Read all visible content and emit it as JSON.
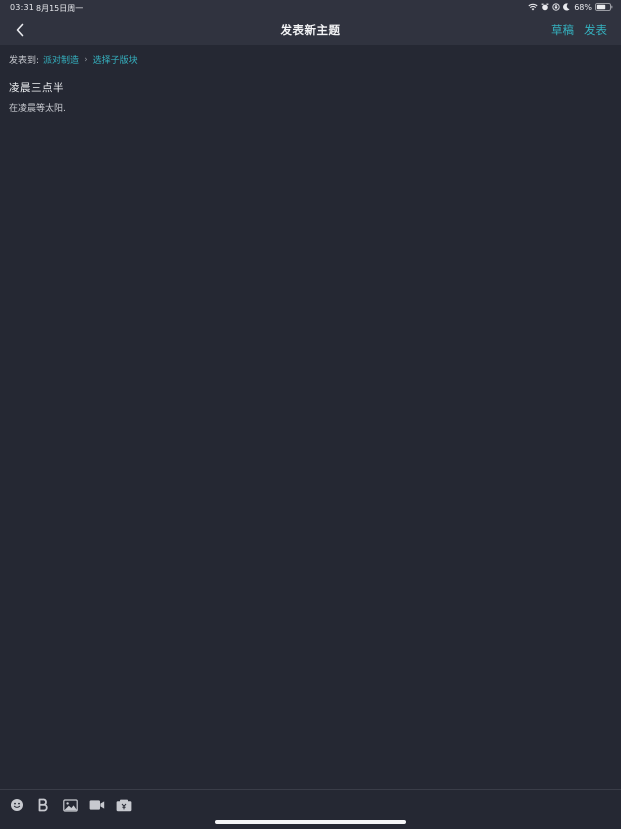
{
  "status_bar": {
    "time": "03:31",
    "date": "8月15日周一",
    "battery_percent": "68%",
    "battery_level": 0.68,
    "icons": [
      "wifi-icon",
      "alarm-icon",
      "rotation-lock-icon",
      "moon-icon",
      "battery-icon"
    ]
  },
  "nav": {
    "back_icon": "chevron-left-icon",
    "title": "发表新主题",
    "draft_label": "草稿",
    "publish_label": "发表"
  },
  "board": {
    "prefix": "发表到:",
    "forum": "派对制造",
    "separator": "›",
    "sub_forum": "选择子版块"
  },
  "post": {
    "title": "凌晨三点半",
    "body": "在凌晨等太阳."
  },
  "toolbar": {
    "items": [
      "emoji-icon",
      "bold-icon",
      "image-icon",
      "video-icon",
      "money-icon"
    ]
  },
  "colors": {
    "background": "#252833",
    "header": "#30333f",
    "accent": "#35b1bf"
  }
}
